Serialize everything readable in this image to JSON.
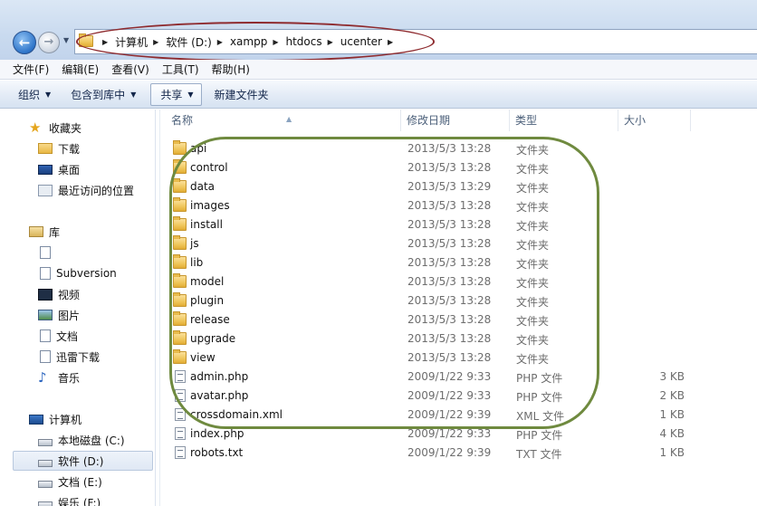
{
  "window": {
    "address_path": [
      "计算机",
      "软件 (D:)",
      "xampp",
      "htdocs",
      "ucenter"
    ]
  },
  "menu": [
    "文件(F)",
    "编辑(E)",
    "查看(V)",
    "工具(T)",
    "帮助(H)"
  ],
  "toolbar": {
    "organize": "组织",
    "include_in_library": "包含到库中",
    "share": "共享",
    "new_folder": "新建文件夹"
  },
  "nav": {
    "favorites": {
      "label": "收藏夹",
      "items": [
        "下载",
        "桌面",
        "最近访问的位置"
      ]
    },
    "libraries": {
      "label": "库",
      "items": [
        "Subversion",
        "视频",
        "图片",
        "文档",
        "迅雷下载",
        "音乐"
      ]
    },
    "computer": {
      "label": "计算机",
      "items": [
        "本地磁盘 (C:)",
        "软件 (D:)",
        "文档 (E:)",
        "娱乐 (F:)"
      ],
      "selected": "软件 (D:)"
    }
  },
  "columns": {
    "name": "名称",
    "date": "修改日期",
    "type": "类型",
    "size": "大小"
  },
  "files": [
    {
      "name": "api",
      "date": "2013/5/3 13:28",
      "type": "文件夹",
      "size": "",
      "kind": "folder"
    },
    {
      "name": "control",
      "date": "2013/5/3 13:28",
      "type": "文件夹",
      "size": "",
      "kind": "folder"
    },
    {
      "name": "data",
      "date": "2013/5/3 13:29",
      "type": "文件夹",
      "size": "",
      "kind": "folder"
    },
    {
      "name": "images",
      "date": "2013/5/3 13:28",
      "type": "文件夹",
      "size": "",
      "kind": "folder"
    },
    {
      "name": "install",
      "date": "2013/5/3 13:28",
      "type": "文件夹",
      "size": "",
      "kind": "folder"
    },
    {
      "name": "js",
      "date": "2013/5/3 13:28",
      "type": "文件夹",
      "size": "",
      "kind": "folder"
    },
    {
      "name": "lib",
      "date": "2013/5/3 13:28",
      "type": "文件夹",
      "size": "",
      "kind": "folder"
    },
    {
      "name": "model",
      "date": "2013/5/3 13:28",
      "type": "文件夹",
      "size": "",
      "kind": "folder"
    },
    {
      "name": "plugin",
      "date": "2013/5/3 13:28",
      "type": "文件夹",
      "size": "",
      "kind": "folder"
    },
    {
      "name": "release",
      "date": "2013/5/3 13:28",
      "type": "文件夹",
      "size": "",
      "kind": "folder"
    },
    {
      "name": "upgrade",
      "date": "2013/5/3 13:28",
      "type": "文件夹",
      "size": "",
      "kind": "folder"
    },
    {
      "name": "view",
      "date": "2013/5/3 13:28",
      "type": "文件夹",
      "size": "",
      "kind": "folder"
    },
    {
      "name": "admin.php",
      "date": "2009/1/22 9:33",
      "type": "PHP 文件",
      "size": "3 KB",
      "kind": "file"
    },
    {
      "name": "avatar.php",
      "date": "2009/1/22 9:33",
      "type": "PHP 文件",
      "size": "2 KB",
      "kind": "file"
    },
    {
      "name": "crossdomain.xml",
      "date": "2009/1/22 9:39",
      "type": "XML 文件",
      "size": "1 KB",
      "kind": "file"
    },
    {
      "name": "index.php",
      "date": "2009/1/22 9:33",
      "type": "PHP 文件",
      "size": "4 KB",
      "kind": "file"
    },
    {
      "name": "robots.txt",
      "date": "2009/1/22 9:39",
      "type": "TXT 文件",
      "size": "1 KB",
      "kind": "file"
    }
  ],
  "annotations": {
    "address_highlight_color": "#8e2b2f",
    "files_highlight_color": "#6f8a3f"
  }
}
